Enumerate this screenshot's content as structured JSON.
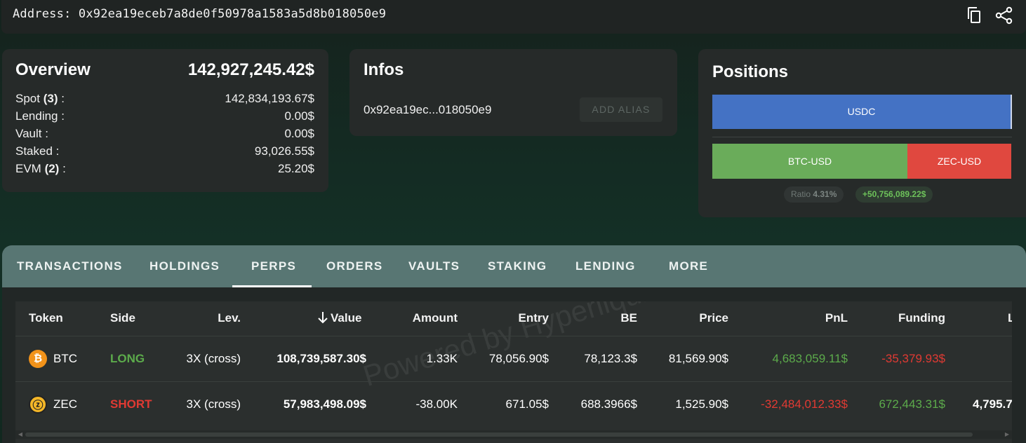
{
  "header": {
    "address_text": "Address: 0x92ea19eceb7a8de0f50978a1583a5d8b018050e9",
    "copy_icon": "copy-icon",
    "share_icon": "share-icon"
  },
  "overview": {
    "title": "Overview",
    "total": "142,927,245.42$",
    "rows": [
      {
        "label": "Spot ",
        "count": "(3)",
        "suffix": " :",
        "value": "142,834,193.67$"
      },
      {
        "label": "Lending :",
        "count": "",
        "suffix": "",
        "value": "0.00$"
      },
      {
        "label": "Vault :",
        "count": "",
        "suffix": "",
        "value": "0.00$"
      },
      {
        "label": "Staked :",
        "count": "",
        "suffix": "",
        "value": "93,026.55$"
      },
      {
        "label": "EVM ",
        "count": "(2)",
        "suffix": " :",
        "value": "25.20$"
      }
    ]
  },
  "infos": {
    "title": "Infos",
    "short_address": "0x92ea19ec...018050e9",
    "add_alias_label": "ADD ALIAS"
  },
  "positions": {
    "title": "Positions",
    "spot_bar": {
      "label": "USDC",
      "color": "#4472c4"
    },
    "perp_bars": [
      {
        "label": "BTC-USD",
        "color": "#6aac5a"
      },
      {
        "label": "ZEC-USD",
        "color": "#e0483f"
      }
    ],
    "ratio_label": "Ratio",
    "ratio_value": "4.31%",
    "pnl_value": "+50,756,089.22$"
  },
  "tabs": {
    "items": [
      "TRANSACTIONS",
      "HOLDINGS",
      "PERPS",
      "ORDERS",
      "VAULTS",
      "STAKING",
      "LENDING",
      "MORE"
    ],
    "active": "PERPS"
  },
  "perps_table": {
    "headers": {
      "token": "Token",
      "side": "Side",
      "lev": "Lev.",
      "value": "Value",
      "amount": "Amount",
      "entry": "Entry",
      "be": "BE",
      "price": "Price",
      "pnl": "PnL",
      "funding": "Funding",
      "liq": "L"
    },
    "sort_icon": "arrow-down-icon",
    "rows": [
      {
        "token": "BTC",
        "icon": "bitcoin-icon",
        "side": "LONG",
        "lev": "3X (cross)",
        "value": "108,739,587.30$",
        "amount": "1.33K",
        "entry": "78,056.90$",
        "be": "78,123.3$",
        "price": "81,569.90$",
        "pnl": "4,683,059.11$",
        "funding": "-35,379.93$",
        "liq": ""
      },
      {
        "token": "ZEC",
        "icon": "zcash-icon",
        "side": "SHORT",
        "lev": "3X (cross)",
        "value": "57,983,498.09$",
        "amount": "-38.00K",
        "entry": "671.05$",
        "be": "688.3966$",
        "price": "1,525.90$",
        "pnl": "-32,484,012.33$",
        "funding": "672,443.31$",
        "liq": "4,795.7"
      }
    ],
    "watermark": "Powered by Hyperliquid"
  },
  "colors": {
    "positive": "#5cab4b",
    "negative": "#e13a33",
    "tabbar": "#587673"
  }
}
